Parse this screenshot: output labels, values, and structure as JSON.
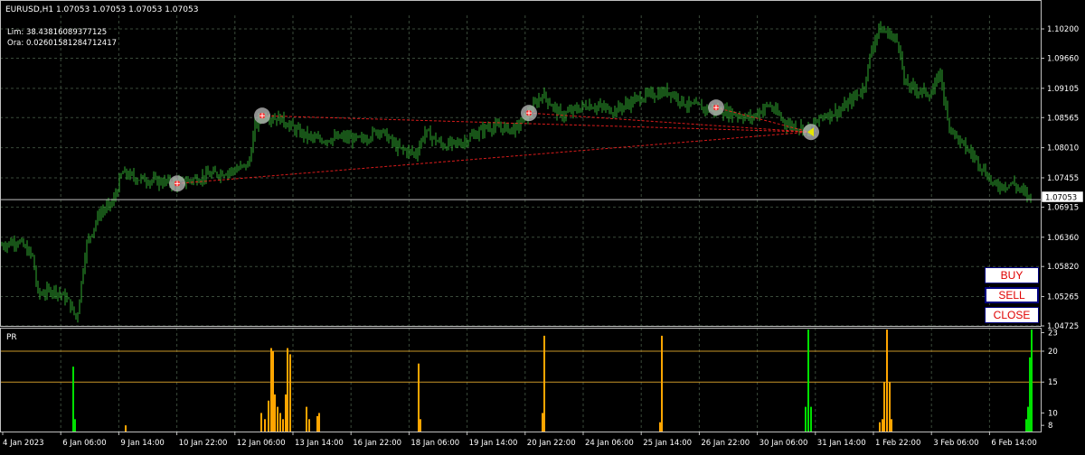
{
  "chart": {
    "symbol_line": "EURUSD,H1  1.07053 1.07053 1.07053 1.07053",
    "lim_line": "Lim: 38.43816089377125",
    "ora_line": "Ora: 0.02601581284712417",
    "current_price_label": "1.07053",
    "current_price": 1.07053,
    "colors": {
      "background": "#000000",
      "grid": "#3a4a3a",
      "candle": "#2fa82f",
      "trendline": "#ff2020",
      "price_line": "#c0c0c0",
      "histogram_orange": "#ffa500",
      "histogram_green": "#00e000",
      "level_line": "#c89628"
    },
    "icons": [
      "signal-marker-icon",
      "arrow-left-marker-icon"
    ]
  },
  "chart_data": [
    {
      "type": "line",
      "name": "main-price-chart",
      "ylim": [
        1.04725,
        1.1045
      ],
      "y_ticks": [
        "1.10200",
        "1.09660",
        "1.09105",
        "1.08565",
        "1.08010",
        "1.07455",
        "1.06915",
        "1.06360",
        "1.05820",
        "1.05265",
        "1.04725"
      ],
      "x_ticks": [
        "4 Jan 2023",
        "6 Jan 06:00",
        "9 Jan 14:00",
        "10 Jan 22:00",
        "12 Jan 06:00",
        "13 Jan 14:00",
        "16 Jan 22:00",
        "18 Jan 06:00",
        "19 Jan 14:00",
        "20 Jan 22:00",
        "24 Jan 06:00",
        "25 Jan 14:00",
        "26 Jan 22:00",
        "30 Jan 06:00",
        "31 Jan 14:00",
        "1 Feb 22:00",
        "3 Feb 06:00",
        "6 Feb 14:00"
      ],
      "close_path": [
        [
          0,
          1.062
        ],
        [
          20,
          1.063
        ],
        [
          36,
          1.06
        ],
        [
          42,
          1.053
        ],
        [
          60,
          1.054
        ],
        [
          75,
          1.052
        ],
        [
          85,
          1.0485
        ],
        [
          95,
          1.062
        ],
        [
          110,
          1.068
        ],
        [
          125,
          1.07
        ],
        [
          135,
          1.0755
        ],
        [
          150,
          1.0745
        ],
        [
          170,
          1.074
        ],
        [
          196,
          1.0735
        ],
        [
          230,
          1.075
        ],
        [
          260,
          1.076
        ],
        [
          275,
          1.077
        ],
        [
          282,
          1.084
        ],
        [
          290,
          1.086
        ],
        [
          310,
          1.0855
        ],
        [
          330,
          1.083
        ],
        [
          350,
          1.0815
        ],
        [
          380,
          1.082
        ],
        [
          400,
          1.0815
        ],
        [
          420,
          1.0835
        ],
        [
          440,
          1.08
        ],
        [
          460,
          1.079
        ],
        [
          470,
          1.083
        ],
        [
          490,
          1.0805
        ],
        [
          510,
          1.081
        ],
        [
          540,
          1.084
        ],
        [
          570,
          1.0835
        ],
        [
          585,
          1.0865
        ],
        [
          600,
          1.09
        ],
        [
          620,
          1.086
        ],
        [
          650,
          1.088
        ],
        [
          680,
          1.087
        ],
        [
          710,
          1.0895
        ],
        [
          740,
          1.0905
        ],
        [
          760,
          1.088
        ],
        [
          790,
          1.087
        ],
        [
          810,
          1.0865
        ],
        [
          830,
          1.0855
        ],
        [
          850,
          1.088
        ],
        [
          870,
          1.0845
        ],
        [
          895,
          1.0835
        ],
        [
          910,
          1.086
        ],
        [
          930,
          1.087
        ],
        [
          955,
          1.091
        ],
        [
          965,
          1.099
        ],
        [
          972,
          1.102
        ],
        [
          985,
          1.101
        ],
        [
          995,
          1.099
        ],
        [
          1000,
          1.092
        ],
        [
          1010,
          1.091
        ],
        [
          1030,
          1.09
        ],
        [
          1040,
          1.094
        ],
        [
          1048,
          1.085
        ],
        [
          1060,
          1.0815
        ],
        [
          1080,
          1.078
        ],
        [
          1100,
          1.073
        ],
        [
          1120,
          1.0735
        ],
        [
          1138,
          1.071
        ]
      ],
      "trendlines": [
        [
          [
            196,
            1.0735
          ],
          [
            895,
            1.083
          ]
        ],
        [
          [
            290,
            1.086
          ],
          [
            895,
            1.083
          ]
        ],
        [
          [
            585,
            1.0865
          ],
          [
            895,
            1.083
          ]
        ],
        [
          [
            792,
            1.0875
          ],
          [
            895,
            1.083
          ]
        ]
      ],
      "markers": [
        {
          "x": 196,
          "y": 1.0735,
          "icon": "signal-marker-icon"
        },
        {
          "x": 290,
          "y": 1.086,
          "icon": "signal-marker-icon"
        },
        {
          "x": 585,
          "y": 1.0865,
          "icon": "signal-marker-icon"
        },
        {
          "x": 792,
          "y": 1.0875,
          "icon": "signal-marker-icon"
        },
        {
          "x": 897,
          "y": 1.083,
          "icon": "arrow-left-marker-icon"
        }
      ]
    },
    {
      "type": "bar",
      "name": "PR",
      "title": "PR",
      "ylim": [
        7,
        23.8
      ],
      "y_ticks": [
        "23",
        "20",
        "15",
        "10",
        "8"
      ],
      "levels": [
        20,
        15
      ],
      "bars": [
        {
          "x": 80,
          "v": 17.5,
          "c": "g"
        },
        {
          "x": 82,
          "v": 9,
          "c": "g"
        },
        {
          "x": 138,
          "v": 8,
          "c": "o"
        },
        {
          "x": 288,
          "v": 10,
          "c": "o"
        },
        {
          "x": 292,
          "v": 9,
          "c": "o"
        },
        {
          "x": 296,
          "v": 12,
          "c": "o"
        },
        {
          "x": 299,
          "v": 20.5,
          "c": "o"
        },
        {
          "x": 301,
          "v": 20,
          "c": "o"
        },
        {
          "x": 303,
          "v": 13,
          "c": "o"
        },
        {
          "x": 306,
          "v": 11,
          "c": "o"
        },
        {
          "x": 309,
          "v": 10,
          "c": "o"
        },
        {
          "x": 312,
          "v": 9,
          "c": "o"
        },
        {
          "x": 315,
          "v": 13,
          "c": "o"
        },
        {
          "x": 317,
          "v": 20.5,
          "c": "o"
        },
        {
          "x": 320,
          "v": 19.5,
          "c": "o"
        },
        {
          "x": 338,
          "v": 11,
          "c": "o"
        },
        {
          "x": 341,
          "v": 9,
          "c": "o"
        },
        {
          "x": 350,
          "v": 9.5,
          "c": "o"
        },
        {
          "x": 352,
          "v": 10,
          "c": "o"
        },
        {
          "x": 462,
          "v": 18,
          "c": "o"
        },
        {
          "x": 464,
          "v": 9,
          "c": "o"
        },
        {
          "x": 599,
          "v": 10,
          "c": "o"
        },
        {
          "x": 601,
          "v": 22.5,
          "c": "o"
        },
        {
          "x": 729,
          "v": 8.5,
          "c": "o"
        },
        {
          "x": 731,
          "v": 22.5,
          "c": "o"
        },
        {
          "x": 890,
          "v": 11,
          "c": "g"
        },
        {
          "x": 893,
          "v": 23.5,
          "c": "g"
        },
        {
          "x": 896,
          "v": 11,
          "c": "g"
        },
        {
          "x": 972,
          "v": 8.5,
          "c": "o"
        },
        {
          "x": 975,
          "v": 9,
          "c": "o"
        },
        {
          "x": 977,
          "v": 15,
          "c": "o"
        },
        {
          "x": 980,
          "v": 23.5,
          "c": "o"
        },
        {
          "x": 983,
          "v": 15,
          "c": "o"
        },
        {
          "x": 985,
          "v": 9,
          "c": "o"
        },
        {
          "x": 1134,
          "v": 9,
          "c": "g"
        },
        {
          "x": 1136,
          "v": 11,
          "c": "g"
        },
        {
          "x": 1138,
          "v": 19,
          "c": "g"
        },
        {
          "x": 1140,
          "v": 23.5,
          "c": "g"
        }
      ]
    }
  ],
  "buttons": {
    "buy": "BUY",
    "sell": "SELL",
    "close": "CLOSE"
  }
}
